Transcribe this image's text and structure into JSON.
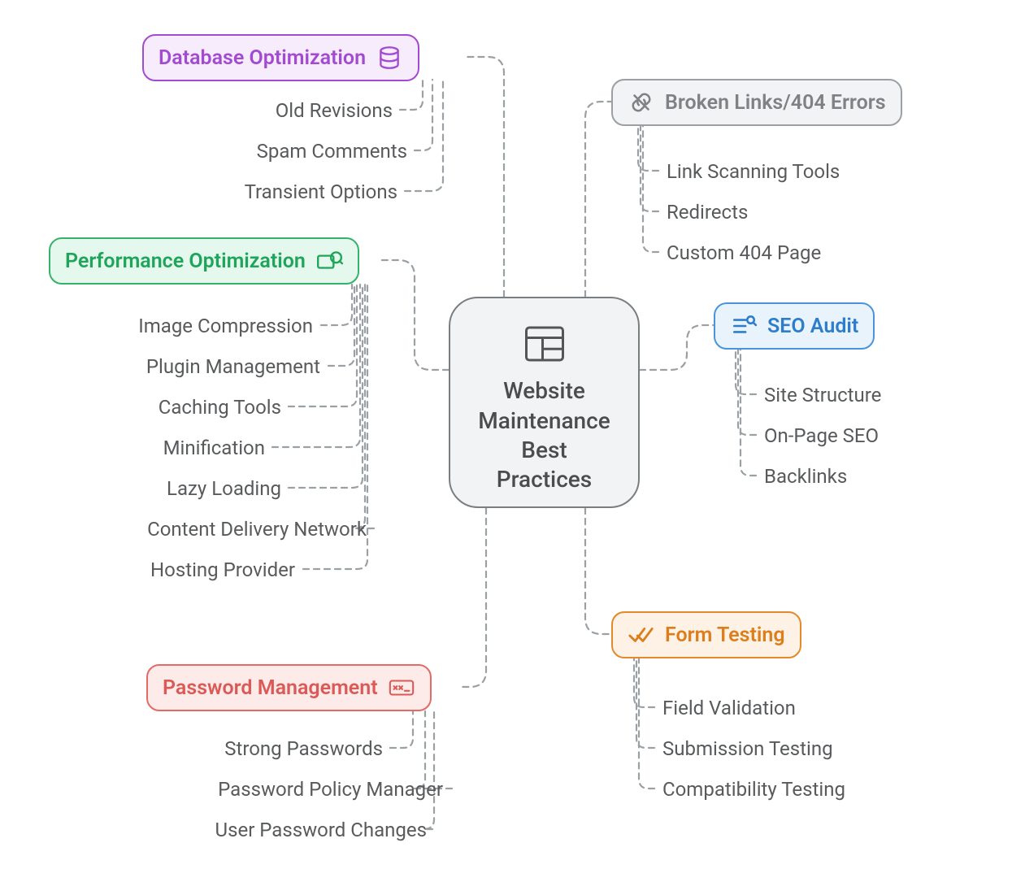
{
  "center": {
    "label": "Website\nMaintenance\nBest\nPractices"
  },
  "branches": {
    "database": {
      "label": "Database Optimization",
      "items": [
        "Old Revisions",
        "Spam Comments",
        "Transient Options"
      ]
    },
    "performance": {
      "label": "Performance Optimization",
      "items": [
        "Image Compression",
        "Plugin Management",
        "Caching Tools",
        "Minification",
        "Lazy Loading",
        "Content Delivery Network",
        "Hosting Provider"
      ]
    },
    "password": {
      "label": "Password Management",
      "items": [
        "Strong Passwords",
        "Password Policy Manager",
        "User Password Changes"
      ]
    },
    "brokenlinks": {
      "label": "Broken Links/404 Errors",
      "items": [
        "Link Scanning Tools",
        "Redirects",
        "Custom 404 Page"
      ]
    },
    "seo": {
      "label": "SEO Audit",
      "items": [
        "Site Structure",
        "On-Page SEO",
        "Backlinks"
      ]
    },
    "form": {
      "label": "Form Testing",
      "items": [
        "Field Validation",
        "Submission Testing",
        "Compatibility Testing"
      ]
    }
  }
}
